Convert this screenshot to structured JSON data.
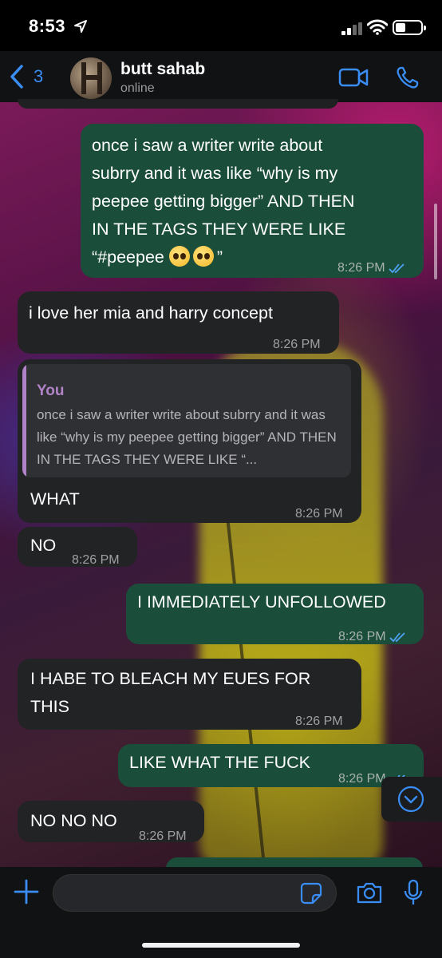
{
  "status_bar": {
    "time": "8:53"
  },
  "header": {
    "back_count": "3",
    "contact_name": "butt sahab",
    "contact_status": "online"
  },
  "messages": [
    {
      "direction": "outgoing",
      "text": "once i saw a writer write about\nsubrry and it was like “why is my\npeepee getting bigger” AND THEN\nIN THE TAGS THEY WERE LIKE",
      "text_last": "“#peepee",
      "emoji": "pleading-face x2",
      "text_close": "”",
      "time": "8:26 PM",
      "read": true
    },
    {
      "direction": "incoming",
      "text": "i love her mia and harry concept",
      "time": "8:26 PM"
    },
    {
      "direction": "incoming",
      "reply_to": {
        "author": "You",
        "text": "once i saw a writer write about subrry and it was like “why is my peepee getting bigger” AND THEN IN THE TAGS THEY WERE LIKE “..."
      },
      "text": "WHAT",
      "time": "8:26 PM"
    },
    {
      "direction": "incoming",
      "text": "NO",
      "time": "8:26 PM"
    },
    {
      "direction": "outgoing",
      "text": "I IMMEDIATELY UNFOLLOWED",
      "time": "8:26 PM",
      "read": true
    },
    {
      "direction": "incoming",
      "text": "I HABE TO BLEACH MY EUES FOR\nTHIS",
      "time": "8:26 PM"
    },
    {
      "direction": "outgoing",
      "text": "LIKE WHAT THE FUCK",
      "time": "8:26 PM",
      "read": true
    },
    {
      "direction": "incoming",
      "text": "NO NO NO",
      "time": "8:26 PM"
    }
  ],
  "composer": {
    "placeholder": "",
    "value": ""
  },
  "colors": {
    "accent": "#3a8df5",
    "outgoing_bubble": "#1b4d3b",
    "incoming_bubble": "#222325",
    "quote_author": "#b083c8",
    "read_ticks": "#4fa3f7"
  },
  "icons": [
    "location-arrow-icon",
    "signal-icon",
    "wifi-icon",
    "battery-icon",
    "back-chevron-icon",
    "video-call-icon",
    "phone-icon",
    "read-ticks-icon",
    "scroll-down-icon",
    "plus-icon",
    "sticker-icon",
    "camera-icon",
    "microphone-icon"
  ]
}
